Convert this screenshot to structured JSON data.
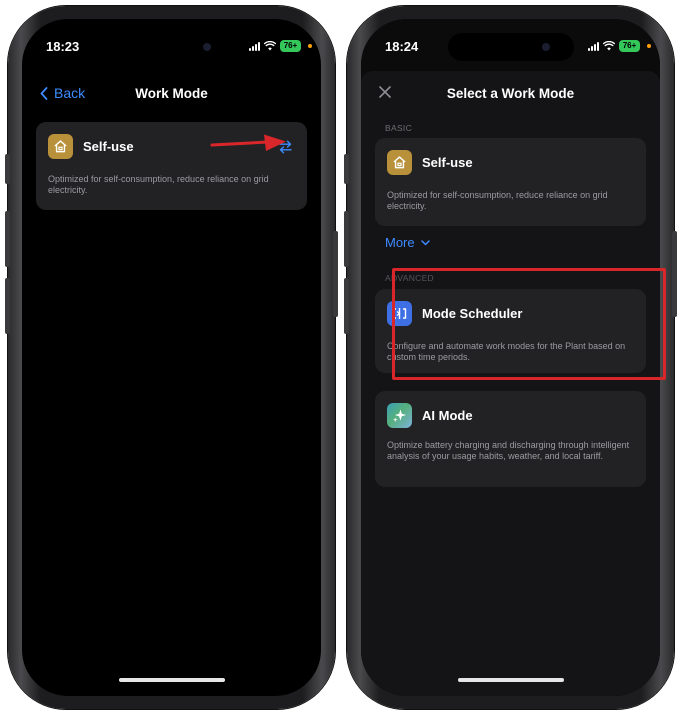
{
  "left_screen": {
    "status": {
      "time": "18:23",
      "battery": "76+"
    },
    "nav": {
      "back_label": "Back",
      "title": "Work Mode"
    },
    "current_mode": {
      "title": "Self-use",
      "description": "Optimized for self-consumption, reduce reliance on grid electricity.",
      "icon": "house-icon",
      "action_icon": "switch-arrows-icon"
    }
  },
  "right_screen": {
    "status": {
      "time": "18:24",
      "battery": "76+"
    },
    "nav": {
      "title": "Select a Work Mode",
      "close_icon": "close-icon"
    },
    "sections": {
      "basic_label": "BASIC",
      "more_label": "More",
      "advanced_label": "ADVANCED"
    },
    "modes": [
      {
        "title": "Self-use",
        "description": "Optimized for self-consumption, reduce reliance on grid electricity.",
        "icon": "house-icon"
      },
      {
        "title": "Mode Scheduler",
        "description": "Configure and automate work modes for the Plant based on custom time periods.",
        "icon": "scheduler-icon"
      },
      {
        "title": "AI Mode",
        "description": "Optimize battery charging and discharging through intelligent analysis of your usage habits, weather, and local tariff.",
        "icon": "sparkle-icon"
      }
    ]
  },
  "colors": {
    "accent_blue": "#3d8bff",
    "highlight_red": "#d9262b",
    "gold": "#b8913a",
    "battery_green": "#34c759"
  }
}
